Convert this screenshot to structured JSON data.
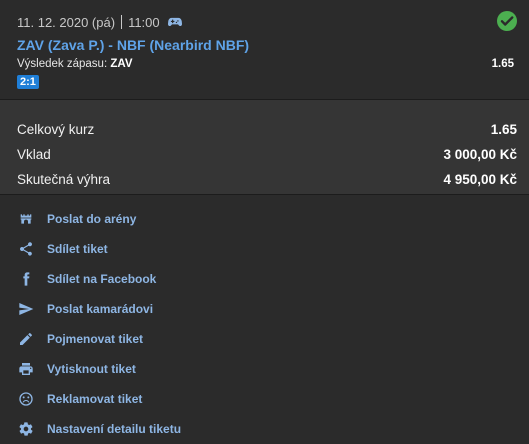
{
  "match": {
    "date": "11. 12. 2020 (pá)",
    "time": "11:00",
    "title": "ZAV (Zava P.) - NBF (Nearbird NBF)",
    "result_label": "Výsledek zápasu:",
    "result_value": "ZAV",
    "odds": "1.65",
    "score": "2:1",
    "status_color": "#4caf50",
    "icons": {
      "game": "gamepad-icon",
      "status": "check-circle-icon"
    }
  },
  "summary": {
    "rows": [
      {
        "label": "Celkový kurz",
        "value": "1.65"
      },
      {
        "label": "Vklad",
        "value": "3 000,00 Kč"
      },
      {
        "label": "Skutečná výhra",
        "value": "4 950,00 Kč"
      }
    ]
  },
  "actions": [
    {
      "label": "Poslat do arény",
      "icon": "arena-icon"
    },
    {
      "label": "Sdílet tiket",
      "icon": "share-icon"
    },
    {
      "label": "Sdílet na Facebook",
      "icon": "facebook-icon"
    },
    {
      "label": "Poslat kamarádovi",
      "icon": "send-icon"
    },
    {
      "label": "Pojmenovat tiket",
      "icon": "pencil-icon"
    },
    {
      "label": "Vytisknout tiket",
      "icon": "printer-icon"
    },
    {
      "label": "Reklamovat tiket",
      "icon": "sad-face-icon"
    },
    {
      "label": "Nastavení detailu tiketu",
      "icon": "gear-icon"
    }
  ],
  "colors": {
    "accent": "#5fa3e8",
    "action_link": "#8eb6e4",
    "score_badge": "#1f7fd8",
    "background": "#2b2b2b",
    "summary_background": "#353535"
  }
}
